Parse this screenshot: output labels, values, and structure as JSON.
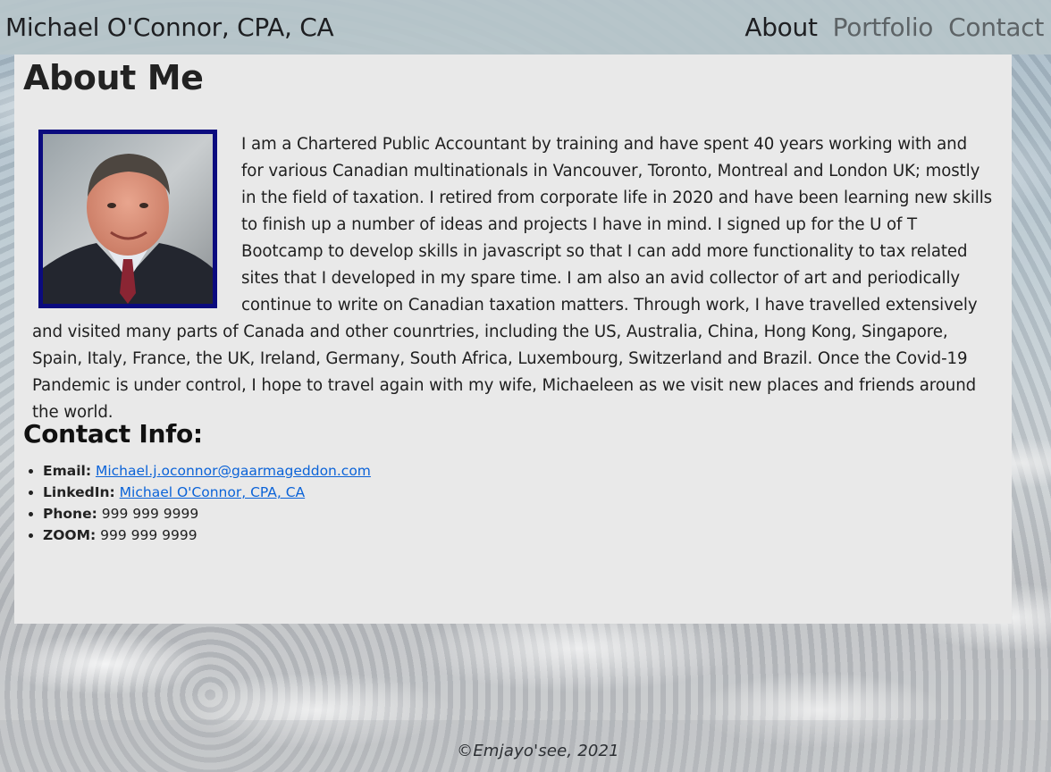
{
  "header": {
    "brand": "Michael O'Connor, CPA, CA",
    "nav": [
      {
        "label": "About",
        "active": true
      },
      {
        "label": "Portfolio",
        "active": false
      },
      {
        "label": "Contact",
        "active": false
      }
    ]
  },
  "about": {
    "title": "About Me",
    "bio": "I am a Chartered Public Accountant by training and have spent 40 years working with and for various Canadian multinationals in Vancouver, Toronto, Montreal and London UK; mostly in the field of taxation. I retired from corporate life in 2020 and have been learning new skills to finish up a number of ideas and projects I have in mind. I signed up for the U of T Bootcamp to develop skills in javascript so that I can add more functionality to tax related sites that I developed in my spare time. I am also an avid collector of art and periodically continue to write on Canadian taxation matters. Through work, I have travelled extensively and visited many parts of Canada and other counrtries, including the US, Australia, China, Hong Kong, Singapore, Spain, Italy, France, the UK, Ireland, Germany, South Africa, Luxembourg, Switzerland and Brazil. Once the Covid-19 Pandemic is under control, I hope to travel again with my wife, Michaeleen as we visit new places and friends around the world."
  },
  "contact": {
    "title": "Contact Info:",
    "items": [
      {
        "key": "Email:",
        "value": "Michael.j.oconnor@gaarmageddon.com",
        "link": true
      },
      {
        "key": "LinkedIn:",
        "value": "Michael O'Connor, CPA, CA",
        "link": true
      },
      {
        "key": "Phone:",
        "value": "999 999 9999",
        "link": false
      },
      {
        "key": "ZOOM:",
        "value": "999 999 9999",
        "link": false
      }
    ]
  },
  "footer": {
    "text": "©Emjayo'see, 2021"
  },
  "colors": {
    "photo_border": "#0b0b7e",
    "link": "#0b63d8",
    "panel_bg": "#e9e9e9",
    "navbar_bg": "#b7c6ca"
  }
}
